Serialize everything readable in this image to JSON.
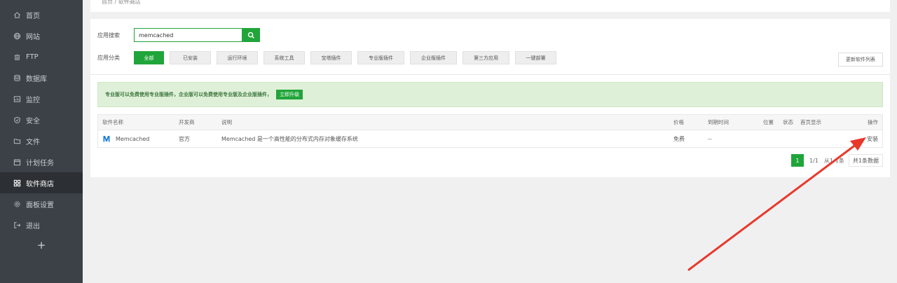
{
  "sidebar": {
    "items": [
      {
        "label": "首页",
        "icon": "home-icon"
      },
      {
        "label": "网站",
        "icon": "globe-icon"
      },
      {
        "label": "FTP",
        "icon": "ftp-icon"
      },
      {
        "label": "数据库",
        "icon": "database-icon"
      },
      {
        "label": "监控",
        "icon": "monitor-icon"
      },
      {
        "label": "安全",
        "icon": "shield-icon"
      },
      {
        "label": "文件",
        "icon": "folder-icon"
      },
      {
        "label": "计划任务",
        "icon": "calendar-icon"
      },
      {
        "label": "软件商店",
        "icon": "grid-icon"
      },
      {
        "label": "面板设置",
        "icon": "gear-icon"
      },
      {
        "label": "退出",
        "icon": "logout-icon"
      }
    ],
    "active_index": 8,
    "add_label": "+"
  },
  "breadcrumb": "首页 / 软件商店",
  "search": {
    "label": "应用搜索",
    "value": "memcached"
  },
  "categories": {
    "label": "应用分类",
    "items": [
      "全部",
      "已安装",
      "运行环境",
      "系统工具",
      "宝塔插件",
      "专业版插件",
      "企业版插件",
      "第三方应用",
      "一键部署"
    ],
    "active_index": 0
  },
  "refresh_label": "更新软件列表",
  "banner": {
    "text": "专业版可以免费使用专业版插件，企业版可以免费使用专业版及企业版插件，",
    "button": "立即升级"
  },
  "table": {
    "headers": {
      "name": "软件名称",
      "developer": "开发商",
      "description": "说明",
      "price": "价格",
      "expire": "到期时间",
      "position": "位置",
      "status": "状态",
      "home": "首页显示",
      "operation": "操作"
    },
    "rows": [
      {
        "name": "Memcached",
        "developer": "官方",
        "description": "Memcached 是一个高性能的分布式内存对象缓存系统",
        "price": "免费",
        "expire": "--",
        "operation": "安装"
      }
    ]
  },
  "pagination": {
    "current": "1",
    "pages": "1/1",
    "range": "从1-1条",
    "total": "共1条数据"
  },
  "colors": {
    "accent": "#20a53a",
    "sidebar_bg": "#3b4147",
    "arrow": "#e8382c"
  }
}
